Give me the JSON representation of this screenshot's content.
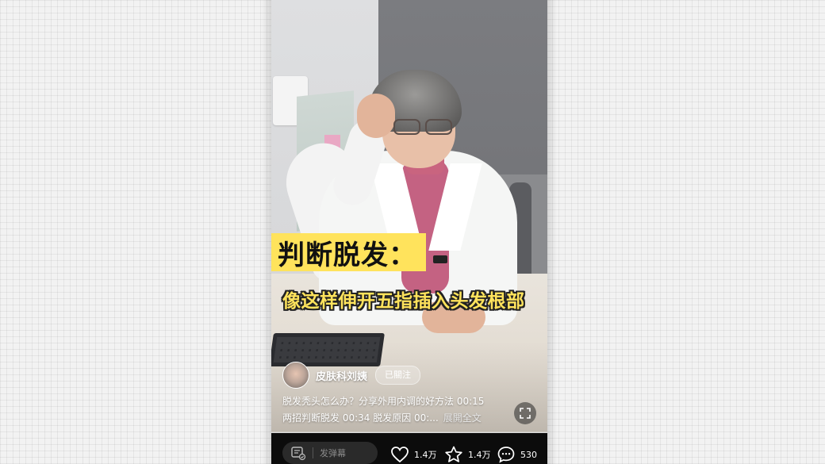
{
  "caption": {
    "title": "判断脱发：",
    "subtitle": "像这样伸开五指插入头发根部"
  },
  "author": {
    "name": "皮肤科刘姨",
    "follow_label": "已關注"
  },
  "description": {
    "line1": "脱发秃头怎么办？分享外用内调的好方法 00:15",
    "line2": "两招判断脱发 00:34  脱发原因 00:...",
    "expand_label": "展開全文"
  },
  "progress": 0.0,
  "bottom_bar": {
    "danmu_placeholder": "发弹幕",
    "like_count": "1.4万",
    "favorite_count": "1.4万",
    "comment_count": "530"
  },
  "colors": {
    "caption_yellow": "#ffe35c",
    "bottom_bar": "#0c0c0c"
  },
  "icons": {
    "danmu": "danmu-icon",
    "like": "heart-icon",
    "favorite": "star-icon",
    "comment": "comment-icon",
    "fullscreen": "fullscreen-icon"
  }
}
